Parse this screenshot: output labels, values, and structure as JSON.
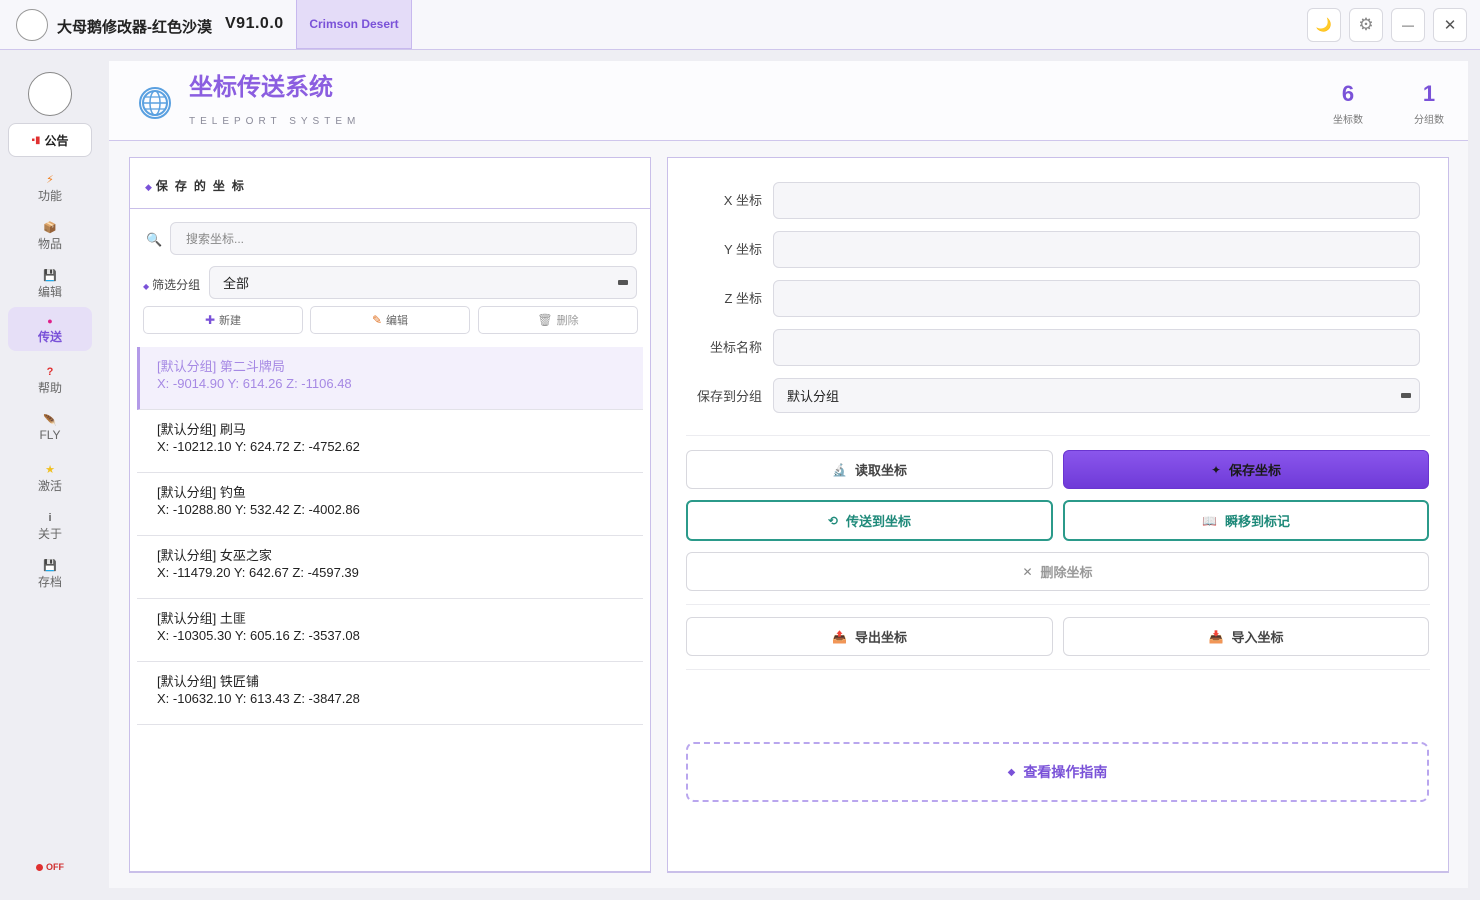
{
  "window": {
    "title": "大母鹅修改器-红色沙漠",
    "version": "V91.0.0",
    "game_tab": "Crimson Desert",
    "controls": {
      "theme": "🌙",
      "settings": "⚙",
      "minimize": "—",
      "close": "✕"
    }
  },
  "sidebar": {
    "notice": {
      "label": "公告",
      "icon": "▪▮"
    },
    "items": [
      {
        "label": "功能",
        "icon": "⚡"
      },
      {
        "label": "物品",
        "icon": "📦"
      },
      {
        "label": "编辑",
        "icon": "💾"
      },
      {
        "label": "传送",
        "icon": "●"
      },
      {
        "label": "帮助",
        "icon": "?"
      },
      {
        "label": "FLY",
        "icon": "🪶"
      },
      {
        "label": "激活",
        "icon": "★"
      },
      {
        "label": "关于",
        "icon": "i"
      },
      {
        "label": "存档",
        "icon": "💾"
      }
    ],
    "active_index": 3,
    "status": "OFF"
  },
  "header": {
    "title": "坐标传送系统",
    "subtitle": "TELEPORT SYSTEM",
    "globe_icon": "🌐",
    "stats": [
      {
        "value": "6",
        "label": "坐标数"
      },
      {
        "value": "1",
        "label": "分组数"
      }
    ]
  },
  "saved_panel": {
    "title": "保存的坐标",
    "title_icon": "◆",
    "search_placeholder": "搜索坐标...",
    "search_icon": "🔍",
    "filter_label": "筛选分组",
    "filter_icon": "◆",
    "filter_value": "全部",
    "buttons": [
      {
        "label": "新建",
        "icon": "✚"
      },
      {
        "label": "编辑",
        "icon": "✎"
      },
      {
        "label": "删除",
        "icon": "🗑"
      }
    ],
    "items": [
      {
        "name": "[默认分组] 第二斗牌局",
        "coords": "X: -9014.90 Y: 614.26 Z: -1106.48"
      },
      {
        "name": "[默认分组] 刷马",
        "coords": "X: -10212.10 Y: 624.72 Z: -4752.62"
      },
      {
        "name": "[默认分组] 钓鱼",
        "coords": "X: -10288.80 Y: 532.42 Z: -4002.86"
      },
      {
        "name": "[默认分组] 女巫之家",
        "coords": "X: -11479.20 Y: 642.67 Z: -4597.39"
      },
      {
        "name": "[默认分组] 土匪",
        "coords": "X: -10305.30 Y: 605.16 Z: -3537.08"
      },
      {
        "name": "[默认分组] 铁匠铺",
        "coords": "X: -10632.10 Y: 613.43 Z: -3847.28"
      }
    ],
    "selected_index": 0
  },
  "form": {
    "x_label": "X 坐标",
    "y_label": "Y 坐标",
    "z_label": "Z 坐标",
    "name_label": "坐标名称",
    "group_label": "保存到分组",
    "group_value": "默认分组",
    "x_value": "",
    "y_value": "",
    "z_value": "",
    "name_value": ""
  },
  "actions": {
    "read": {
      "label": "读取坐标",
      "icon": "🔬"
    },
    "save": {
      "label": "保存坐标",
      "icon": "✦"
    },
    "teleport": {
      "label": "传送到坐标",
      "icon": "⟲"
    },
    "blink": {
      "label": "瞬移到标记",
      "icon": "📖"
    },
    "delete": {
      "label": "删除坐标",
      "icon": "✕"
    },
    "export": {
      "label": "导出坐标",
      "icon": "📤"
    },
    "import": {
      "label": "导入坐标",
      "icon": "📥"
    },
    "guide": {
      "label": "查看操作指南",
      "icon": "◆"
    }
  },
  "colors": {
    "accent": "#7a52d8",
    "teal": "#2b9a8a",
    "border": "#c9bfe9",
    "danger": "#e03030"
  }
}
